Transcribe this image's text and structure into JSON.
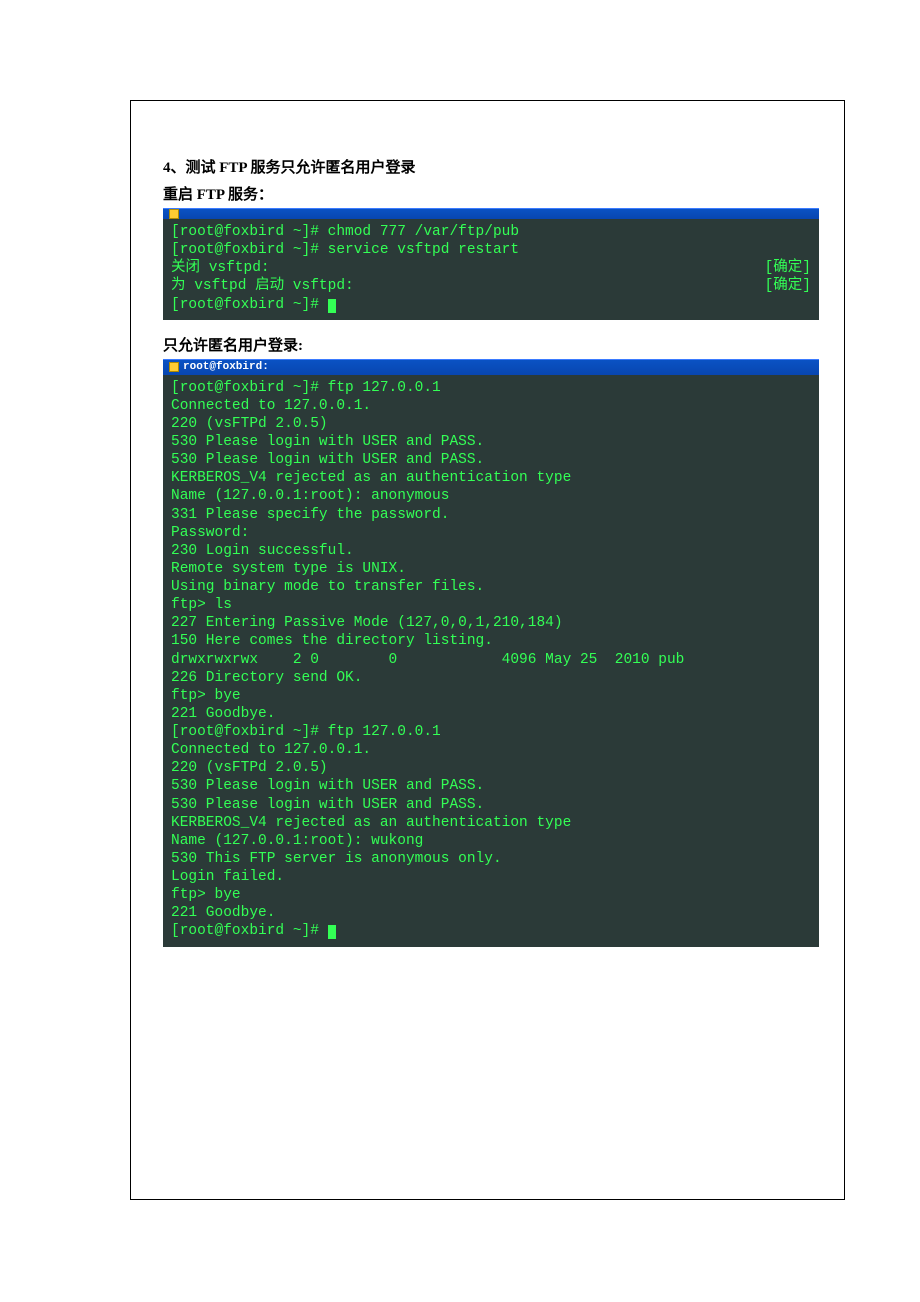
{
  "heading": "4、测试 FTP 服务只允许匿名用户登录",
  "sub1": "重启 FTP 服务：",
  "sub2": "只允许匿名用户登录:",
  "titlebar1": "",
  "titlebar2": "root@foxbird:",
  "term1": {
    "l1": "[root@foxbird ~]# chmod 777 /var/ftp/pub",
    "l2": "[root@foxbird ~]# service vsftpd restart",
    "l3_left": "关闭 vsftpd:",
    "l3_right": "[确定]",
    "l4_left": "为 vsftpd 启动 vsftpd:",
    "l4_right": "[确定]",
    "l5": "[root@foxbird ~]# "
  },
  "term2": {
    "lines": [
      "[root@foxbird ~]# ftp 127.0.0.1",
      "Connected to 127.0.0.1.",
      "220 (vsFTPd 2.0.5)",
      "530 Please login with USER and PASS.",
      "530 Please login with USER and PASS.",
      "KERBEROS_V4 rejected as an authentication type",
      "Name (127.0.0.1:root): anonymous",
      "331 Please specify the password.",
      "Password:",
      "230 Login successful.",
      "Remote system type is UNIX.",
      "Using binary mode to transfer files.",
      "ftp> ls",
      "227 Entering Passive Mode (127,0,0,1,210,184)",
      "150 Here comes the directory listing.",
      "drwxrwxrwx    2 0        0            4096 May 25  2010 pub",
      "226 Directory send OK.",
      "ftp> bye",
      "221 Goodbye.",
      "[root@foxbird ~]# ftp 127.0.0.1",
      "Connected to 127.0.0.1.",
      "220 (vsFTPd 2.0.5)",
      "530 Please login with USER and PASS.",
      "530 Please login with USER and PASS.",
      "KERBEROS_V4 rejected as an authentication type",
      "Name (127.0.0.1:root): wukong",
      "530 This FTP server is anonymous only.",
      "Login failed.",
      "ftp> bye",
      "221 Goodbye.",
      "[root@foxbird ~]# "
    ]
  }
}
